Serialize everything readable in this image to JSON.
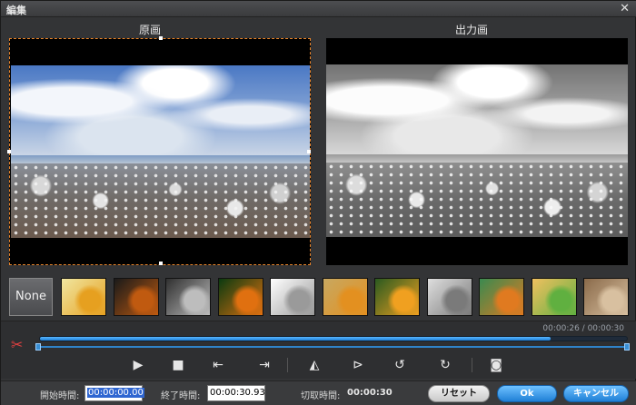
{
  "window": {
    "title": "編集",
    "close_glyph": "✕"
  },
  "preview": {
    "original_label": "原画",
    "output_label": "出力画"
  },
  "effects": {
    "none_label": "None",
    "thumbnails": [
      {
        "name": "fx-soft-light",
        "colors": [
          "#f0e6a0",
          "#e6a020"
        ]
      },
      {
        "name": "fx-dark-contrast",
        "colors": [
          "#1a1a1a",
          "#c05a10"
        ]
      },
      {
        "name": "fx-grayscale",
        "colors": [
          "#303030",
          "#bdbdbd"
        ]
      },
      {
        "name": "fx-green-glow",
        "colors": [
          "#0a3a10",
          "#e07010"
        ]
      },
      {
        "name": "fx-sketch",
        "colors": [
          "#ffffff",
          "#9a9a9a"
        ]
      },
      {
        "name": "fx-blur",
        "colors": [
          "#c8a860",
          "#e39020"
        ]
      },
      {
        "name": "fx-sharpen",
        "colors": [
          "#2a5a20",
          "#f0a020"
        ]
      },
      {
        "name": "fx-emboss",
        "colors": [
          "#dedede",
          "#7a7a7a"
        ]
      },
      {
        "name": "fx-noise",
        "colors": [
          "#3a8a50",
          "#e07a20"
        ]
      },
      {
        "name": "fx-mosaic",
        "colors": [
          "#f0c060",
          "#60b040"
        ]
      },
      {
        "name": "fx-sepia",
        "colors": [
          "#8a6a4a",
          "#d8c0a0"
        ]
      }
    ]
  },
  "timeline": {
    "readout": "00:00:26 / 00:00:30",
    "progress": 0.87
  },
  "controls": [
    {
      "name": "play-icon",
      "glyph": "▶"
    },
    {
      "name": "stop-icon",
      "glyph": "■"
    },
    {
      "name": "set-start-icon",
      "glyph": "⇤"
    },
    {
      "name": "set-end-icon",
      "glyph": "⇥"
    },
    {
      "name": "flip-horizontal-icon",
      "glyph": "◭"
    },
    {
      "name": "flip-vertical-icon",
      "glyph": "⊳"
    },
    {
      "name": "rotate-left-icon",
      "glyph": "↺"
    },
    {
      "name": "rotate-right-icon",
      "glyph": "↻"
    },
    {
      "name": "snapshot-icon",
      "glyph": "◙"
    }
  ],
  "bottom": {
    "start_label": "開始時間:",
    "start_value": "00:00:00.00",
    "end_label": "終了時間:",
    "end_value": "00:00:30.93",
    "cut_label": "切取時間:",
    "cut_value": "00:00:30",
    "reset_label": "リセット",
    "ok_label": "Ok",
    "cancel_label": "キャンセル"
  },
  "colors": {
    "accent": "#1f7fd6",
    "selection_border": "#e8842a",
    "cut_icon": "#e04040"
  }
}
